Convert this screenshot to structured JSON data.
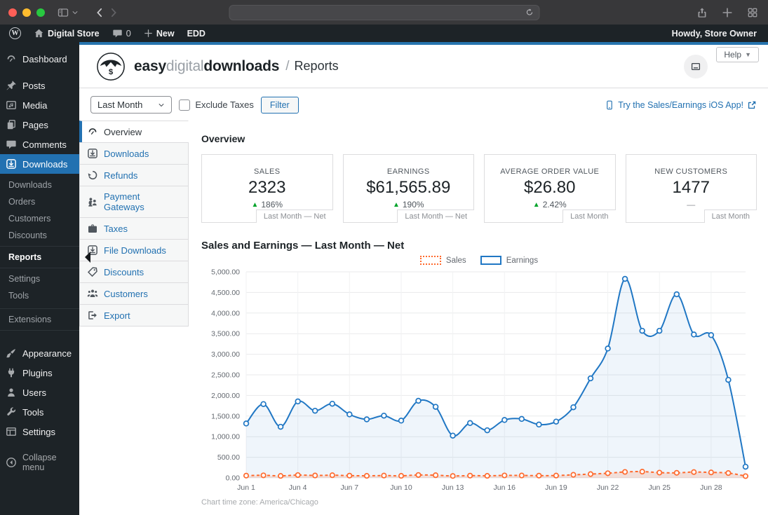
{
  "browser": {
    "traffic_light_colors": [
      "#ff5f57",
      "#febc2e",
      "#28c840"
    ]
  },
  "admin_bar": {
    "site_name": "Digital Store",
    "comments_count": "0",
    "new_label": "New",
    "edd_label": "EDD",
    "howdy": "Howdy, Store Owner"
  },
  "sidebar": {
    "items": [
      {
        "label": "Dashboard",
        "icon": "gauge-icon"
      },
      {
        "label": "Posts",
        "icon": "pushpin-icon"
      },
      {
        "label": "Media",
        "icon": "media-icon"
      },
      {
        "label": "Pages",
        "icon": "pages-icon"
      },
      {
        "label": "Comments",
        "icon": "comment-icon"
      },
      {
        "label": "Downloads",
        "icon": "download-icon"
      }
    ],
    "downloads_submenu": [
      "Downloads",
      "Orders",
      "Customers",
      "Discounts",
      "Reports",
      "Settings",
      "Tools"
    ],
    "current_submenu_item": "Reports",
    "extensions_label": "Extensions",
    "lower_items": [
      {
        "label": "Appearance",
        "icon": "brush-icon"
      },
      {
        "label": "Plugins",
        "icon": "plug-icon"
      },
      {
        "label": "Users",
        "icon": "user-icon"
      },
      {
        "label": "Tools",
        "icon": "wrench-icon"
      },
      {
        "label": "Settings",
        "icon": "settings-panel-icon"
      }
    ],
    "collapse_label": "Collapse menu"
  },
  "edd_header": {
    "brand": {
      "easy": "easy",
      "digital": "digital",
      "downloads": "downloads"
    },
    "breadcrumb_separator": "/",
    "page_title": "Reports",
    "help_label": "Help"
  },
  "filter_bar": {
    "date_range_value": "Last Month",
    "exclude_taxes_label": "Exclude Taxes",
    "filter_button_label": "Filter",
    "ios_app_link": "Try the Sales/Earnings iOS App!"
  },
  "report_tabs": [
    {
      "label": "Overview",
      "icon": "gauge-icon"
    },
    {
      "label": "Downloads",
      "icon": "download-icon"
    },
    {
      "label": "Refunds",
      "icon": "undo-icon"
    },
    {
      "label": "Payment Gateways",
      "icon": "gateway-icon"
    },
    {
      "label": "Taxes",
      "icon": "briefcase-icon"
    },
    {
      "label": "File Downloads",
      "icon": "file-download-icon"
    },
    {
      "label": "Discounts",
      "icon": "tag-icon"
    },
    {
      "label": "Customers",
      "icon": "group-icon"
    },
    {
      "label": "Export",
      "icon": "export-icon"
    }
  ],
  "overview": {
    "heading": "Overview",
    "tiles": [
      {
        "label": "SALES",
        "value": "2323",
        "delta_arrow": "▲",
        "delta": "186%",
        "period": "Last Month — Net"
      },
      {
        "label": "EARNINGS",
        "value": "$61,565.89",
        "delta_arrow": "▲",
        "delta": "190%",
        "period": "Last Month — Net"
      },
      {
        "label": "AVERAGE ORDER VALUE",
        "value": "$26.80",
        "delta_arrow": "▲",
        "delta": "2.42%",
        "period": "Last Month"
      },
      {
        "label": "NEW CUSTOMERS",
        "value": "1477",
        "delta_arrow": "",
        "delta": "—",
        "period": "Last Month"
      }
    ]
  },
  "chart": {
    "heading": "Sales and Earnings — Last Month — Net",
    "timezone_caption": "Chart time zone: America/Chicago"
  },
  "chart_data": {
    "type": "line",
    "title": "Sales and Earnings — Last Month — Net",
    "x": [
      "Jun 1",
      "Jun 2",
      "Jun 3",
      "Jun 4",
      "Jun 5",
      "Jun 6",
      "Jun 7",
      "Jun 8",
      "Jun 9",
      "Jun 10",
      "Jun 11",
      "Jun 12",
      "Jun 13",
      "Jun 14",
      "Jun 15",
      "Jun 16",
      "Jun 17",
      "Jun 18",
      "Jun 19",
      "Jun 20",
      "Jun 21",
      "Jun 22",
      "Jun 23",
      "Jun 24",
      "Jun 25",
      "Jun 26",
      "Jun 27",
      "Jun 28",
      "Jun 29",
      "Jun 30"
    ],
    "x_ticks": [
      "Jun 1",
      "Jun 4",
      "Jun 7",
      "Jun 10",
      "Jun 13",
      "Jun 16",
      "Jun 19",
      "Jun 22",
      "Jun 25",
      "Jun 28"
    ],
    "ylim": [
      0,
      5000
    ],
    "y_tick_step": 500,
    "grid": true,
    "legend_position": "top",
    "series": [
      {
        "name": "Sales",
        "color": "#ff6a2d",
        "line_style": "dashed",
        "values": [
          55,
          62,
          48,
          68,
          58,
          64,
          55,
          50,
          56,
          50,
          70,
          64,
          46,
          55,
          50,
          60,
          58,
          54,
          56,
          74,
          92,
          112,
          145,
          152,
          128,
          122,
          142,
          132,
          118,
          42
        ]
      },
      {
        "name": "Earnings",
        "color": "#2077c4",
        "line_style": "solid",
        "values": [
          1320,
          1790,
          1240,
          1855,
          1630,
          1800,
          1540,
          1420,
          1510,
          1390,
          1870,
          1725,
          1025,
          1330,
          1155,
          1405,
          1430,
          1295,
          1365,
          1715,
          2415,
          3140,
          4830,
          3570,
          3570,
          4455,
          3480,
          3465,
          2380,
          270
        ]
      }
    ]
  }
}
